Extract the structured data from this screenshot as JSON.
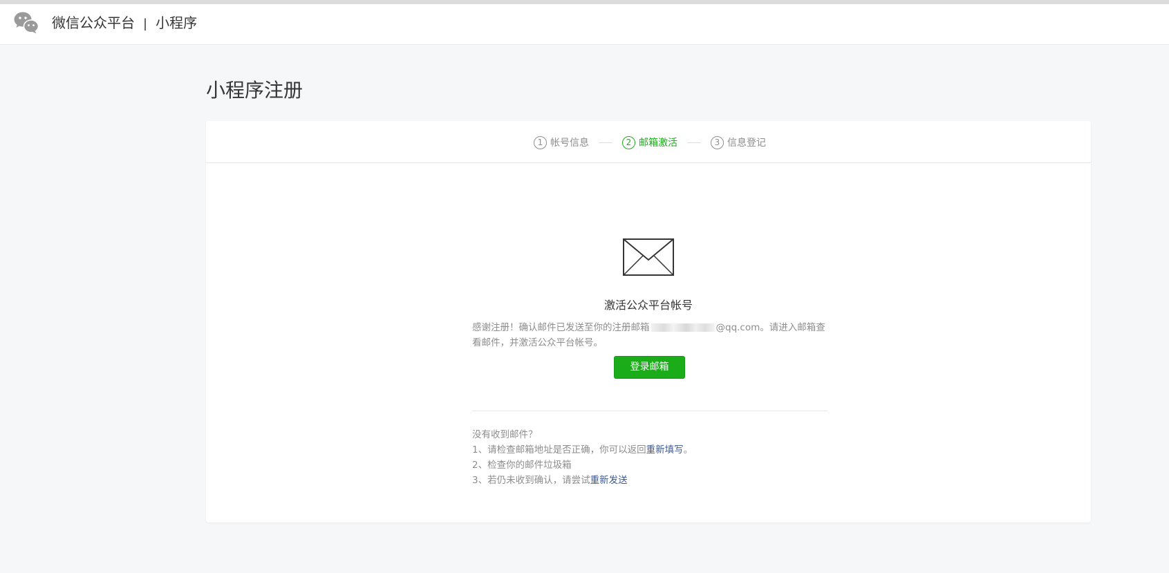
{
  "header": {
    "brand_name": "微信公众平台",
    "separator": "|",
    "product": "小程序"
  },
  "page": {
    "title": "小程序注册"
  },
  "steps": [
    {
      "num": "1",
      "label": "帐号信息",
      "state": "done"
    },
    {
      "num": "2",
      "label": "邮箱激活",
      "state": "active"
    },
    {
      "num": "3",
      "label": "信息登记",
      "state": "pending"
    }
  ],
  "activation": {
    "title": "激活公众平台帐号",
    "desc_part1": "感谢注册！确认邮件已发送至你的注册邮箱",
    "email_domain": "@qq.com",
    "desc_part2": "。请进入邮箱查看邮件，并激活公众平台帐号。",
    "login_button": "登录邮箱"
  },
  "help": {
    "question": "没有收到邮件？",
    "item1_prefix": "1、请检查邮箱地址是否正确，你可以返回",
    "item1_link": "重新填写",
    "item1_suffix": "。",
    "item2": "2、检查你的邮件垃圾箱",
    "item3_prefix": "3、若仍未收到确认，请尝试",
    "item3_link": "重新发送"
  },
  "colors": {
    "accent_green": "#1aad19",
    "link_blue": "#3d5a93",
    "muted_text": "#8d8d8d",
    "background": "#f6f7f9"
  },
  "icons": {
    "logo": "wechat-logo-icon",
    "mail": "envelope-icon"
  }
}
